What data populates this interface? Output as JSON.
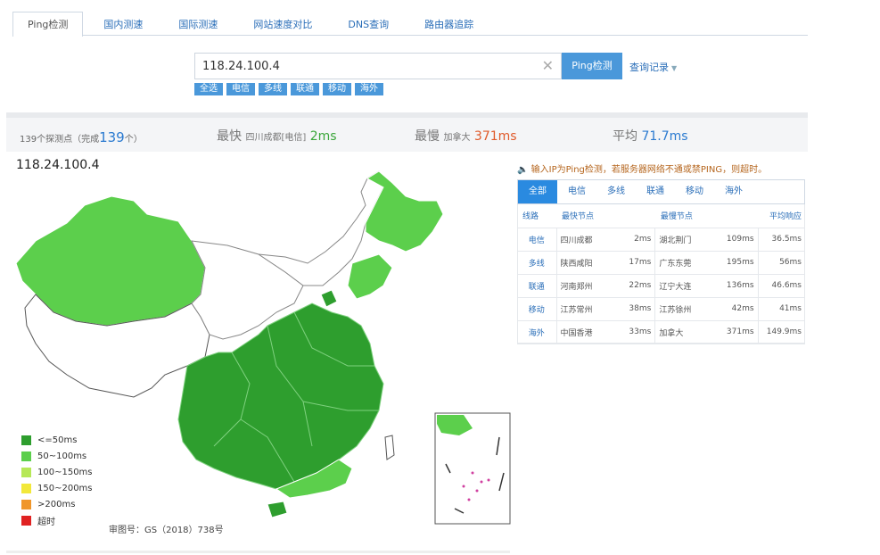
{
  "tabs": [
    "Ping检测",
    "国内测速",
    "国际测速",
    "网站速度对比",
    "DNS查询",
    "路由器追踪"
  ],
  "search": {
    "value": "118.24.100.4",
    "button": "Ping检测",
    "history": "查询记录"
  },
  "filters": [
    "全选",
    "电信",
    "多线",
    "联通",
    "移动",
    "海外"
  ],
  "stats": {
    "nodes_prefix": "139个探测点（完成",
    "nodes_done": "139",
    "nodes_suffix": "个）",
    "fastest_label": "最快",
    "fastest_node": "四川成都[电信]",
    "fastest_value": "2ms",
    "slowest_label": "最慢",
    "slowest_node": "加拿大",
    "slowest_value": "371ms",
    "avg_label": "平均",
    "avg_value": "71.7ms"
  },
  "map": {
    "ip": "118.24.100.4",
    "approval": "审图号：GS（2018）738号"
  },
  "legend": [
    {
      "label": "<=50ms",
      "color": "#2e9e2e"
    },
    {
      "label": "50~100ms",
      "color": "#5ccf4c"
    },
    {
      "label": "100~150ms",
      "color": "#b6e857"
    },
    {
      "label": "150~200ms",
      "color": "#f2e83a"
    },
    {
      "label": ">200ms",
      "color": "#f0962a"
    },
    {
      "label": "超时",
      "color": "#e02222"
    }
  ],
  "notice": "输入IP为Ping检测，若服务器网络不通或禁PING，则超时。",
  "result_tabs": [
    "全部",
    "电信",
    "多线",
    "联通",
    "移动",
    "海外"
  ],
  "result_headers": [
    "线路",
    "最快节点",
    "最慢节点",
    "平均响应"
  ],
  "result_rows": [
    {
      "line": "电信",
      "fast_node": "四川成都",
      "fast_ms": "2ms",
      "slow_node": "湖北荆门",
      "slow_ms": "109ms",
      "avg": "36.5ms"
    },
    {
      "line": "多线",
      "fast_node": "陕西咸阳",
      "fast_ms": "17ms",
      "slow_node": "广东东莞",
      "slow_ms": "195ms",
      "avg": "56ms"
    },
    {
      "line": "联通",
      "fast_node": "河南郑州",
      "fast_ms": "22ms",
      "slow_node": "辽宁大连",
      "slow_ms": "136ms",
      "avg": "46.6ms"
    },
    {
      "line": "移动",
      "fast_node": "江苏常州",
      "fast_ms": "38ms",
      "slow_node": "江苏徐州",
      "slow_ms": "42ms",
      "avg": "41ms"
    },
    {
      "line": "海外",
      "fast_node": "中国香港",
      "fast_ms": "33ms",
      "slow_node": "加拿大",
      "slow_ms": "371ms",
      "avg": "149.9ms"
    }
  ]
}
